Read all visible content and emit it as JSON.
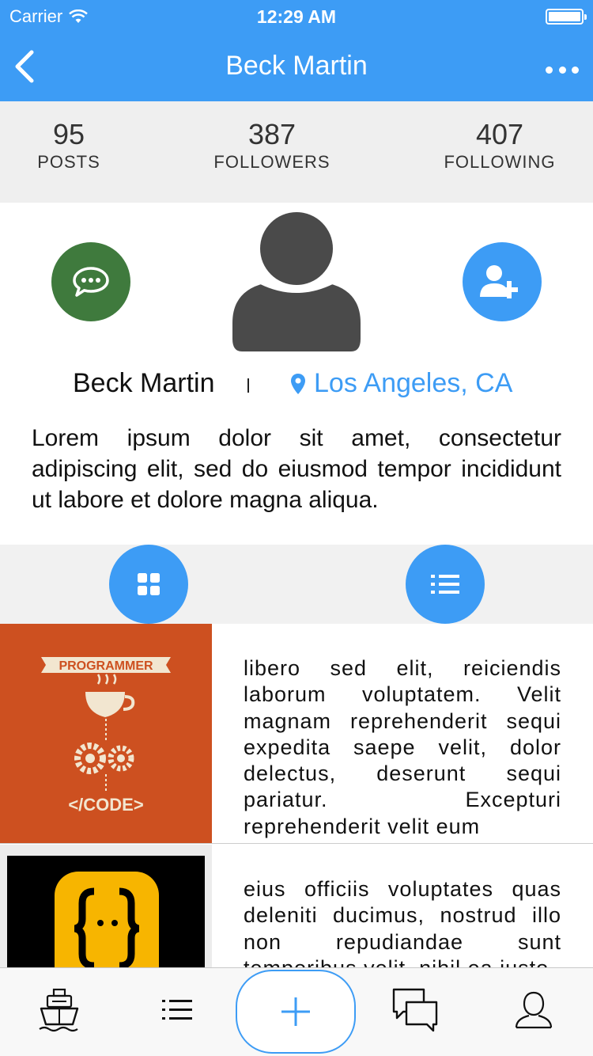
{
  "status_bar": {
    "carrier": "Carrier",
    "time": "12:29 AM"
  },
  "nav": {
    "title": "Beck Martin",
    "back_icon": "chevron-left-icon",
    "more_icon": "more-icon"
  },
  "stats": [
    {
      "value": "95",
      "label": "POSTS"
    },
    {
      "value": "387",
      "label": "FOLLOWERS"
    },
    {
      "value": "407",
      "label": "FOLLOWING"
    }
  ],
  "profile": {
    "name": "Beck Martin",
    "separator": "|",
    "location": "Los Angeles, CA",
    "bio": "Lorem ipsum dolor sit amet, consectetur adipiscing elit, sed do eiusmod tempor incididunt ut labore et dolore magna aliqua."
  },
  "posts": [
    {
      "thumb_title": "PROGRAMMER",
      "thumb_caption": "</CODE>",
      "text": " libero sed elit, reiciendis laborum voluptatem. Velit magnam reprehenderit sequi expedita saepe velit, dolor delectus, deserunt sequi pariatur. Excepturi reprehenderit velit eum"
    },
    {
      "text": " eius officiis voluptates quas deleniti ducimus, nostrud illo non repudiandae sunt temporibus velit, nihil ea iusto"
    }
  ],
  "colors": {
    "accent": "#3d9cf5",
    "message_green": "#3f7a3d",
    "avatar_gray": "#4a4a4a",
    "post_orange": "#cd5020"
  }
}
